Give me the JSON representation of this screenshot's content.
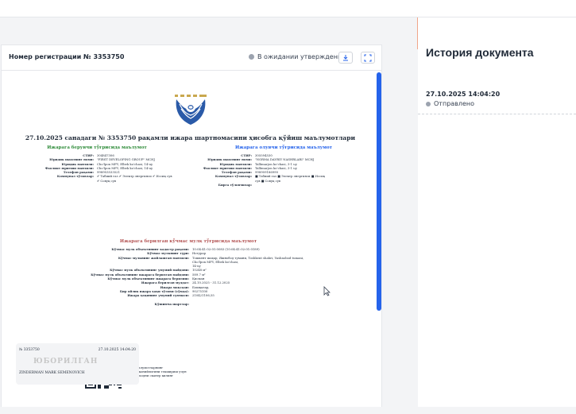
{
  "header": {
    "registration_title": "Номер регистрации № 3353750",
    "status_label": "В ожидании утверждения",
    "download_icon": "download-icon",
    "expand_icon": "expand-icon"
  },
  "history": {
    "title": "История документа",
    "entries": [
      {
        "date": "27.10.2025 14:04:20",
        "status": "Отправлено"
      }
    ]
  },
  "document": {
    "title": "27.10.2025 санадаги № 3353750 рақамли ижара шартномасини ҳисобга қўйиш маълумотлари",
    "lessor_section": "Ижарага берувчи тўғрисида маълумот",
    "lessee_section": "Ижарага олувчи тўғрисида маълумот",
    "lessor_rows": [
      {
        "k": "СТИР:",
        "v": "304847306"
      },
      {
        "k": "Юридик шахснинг номи:",
        "v": "\"FIRST DEVELOPING GROUP\" MCHJ"
      },
      {
        "k": "Юридик манзили:",
        "v": "Cho'lpon MFY, Elbek ko'chasi, 14-uy"
      },
      {
        "k": "Фаолият юритиш манзили:",
        "v": "Cho'lpon MFY, Elbek ko'chasi, 14-uy"
      },
      {
        "k": "Телефон рақами:",
        "v": "998903533521"
      },
      {
        "k": "Коммунал тўловлар:",
        "v": "✔ Табиий газ ✔ Электр энергияси ✔ Иссиқ сув"
      },
      {
        "k": "",
        "v": "✔ Совуқ сув"
      }
    ],
    "lessee_rows": [
      {
        "k": "СТИР:",
        "v": "305594530"
      },
      {
        "k": "Юридик шахснинг номи:",
        "v": "\"NORMA DAVRIY NASHRLARI\" MCHJ"
      },
      {
        "k": "Юридик манзили:",
        "v": "Tallimarjon ko'chasi, 3-1 uy"
      },
      {
        "k": "Фаолият юритиш манзили:",
        "v": "Tallimarjon ko'chasi, 3-1 uy"
      },
      {
        "k": "Телефон рақами:",
        "v": "998909186990"
      },
      {
        "k": "Коммунал тўловлар:",
        "v": "■ Табиий газ ■ Электр энергияси ■ Иссиқ"
      },
      {
        "k": "",
        "v": "сув ■ Совуқ сув"
      },
      {
        "k": "Бирга тўловчилар:",
        "v": ""
      }
    ],
    "property_section": "Ижарага берилган кўчмас мулк тўғрисида маълумот",
    "property_rows": [
      {
        "k": "Кўчмас мулк объектининг кадастр рақами:",
        "v": "10:04:41:02:01:0083 (10:04:41:02:01:0189)"
      },
      {
        "k": "Кўчмас мулкнинг тури:",
        "v": "Нотурар"
      },
      {
        "k": "Кўчмас мулкнинг жойлашган манзили:",
        "v": "Тошкент шаҳар, Яшнобод тумани, Toshkent shahri, Yashnobod tumani, Cho'lpon MFY, Elbek ko'chasi,"
      },
      {
        "k": "",
        "v": "14-uy"
      },
      {
        "k": "Кўчмас мулк объектининг умумий майдони:",
        "v": "10248 м²"
      },
      {
        "k": "Кўчмас мулк объектининг ижарага берилган майдони:",
        "v": "589.7 м²"
      },
      {
        "k": "Кўчмас мулк объектининг ижарага берилиш:",
        "v": "Қисман"
      },
      {
        "k": "Ижарага берилган муддат:",
        "v": "24.10.2025 - 31.12.2025"
      },
      {
        "k": "Ижара мақсади:",
        "v": "Бошқалар,"
      },
      {
        "k": "Бир ойлик ижара ҳақи тўлови (сўмда):",
        "v": "90275100"
      },
      {
        "k": "Ижара ҳақининг умумий суммаси:",
        "v": "210421106,55"
      },
      {
        "k": "",
        "v": ""
      },
      {
        "k": "Қўшимча шартлар:",
        "v": ""
      }
    ],
    "qr_note": [
      "Маълумотларнинг",
      "ҳаққонийлигини текшириш учун",
      "QR-кодни скaнер қилинг"
    ]
  },
  "signature": {
    "reg": "№ 3353750",
    "time": "27.10.2025 14:04:20",
    "stamp": "ЮБОРИЛГАН",
    "name": "ZINDERMAN MARK SEMENOVICH"
  },
  "colors": {
    "accent_blue": "#2563eb",
    "lessor_green": "#2f8c3a",
    "property_red": "#b45656",
    "divider_orange": "#f0a58a"
  }
}
